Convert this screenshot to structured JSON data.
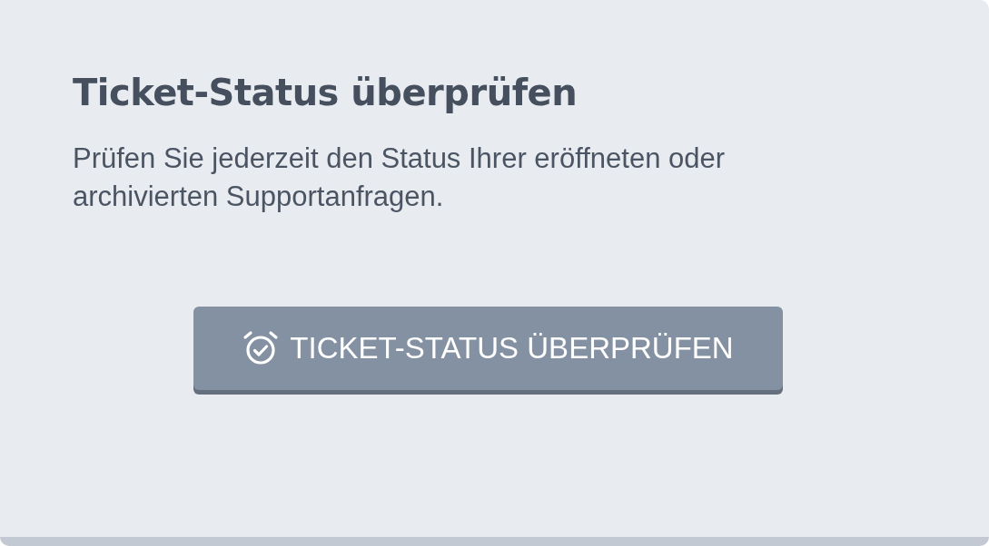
{
  "card": {
    "title": "Ticket-Status überprüfen",
    "description": "Prüfen Sie jederzeit den Status Ihrer eröffneten oder archivierten Supportanfragen.",
    "button": {
      "label": "TICKET-STATUS ÜBERPRÜFEN"
    }
  }
}
